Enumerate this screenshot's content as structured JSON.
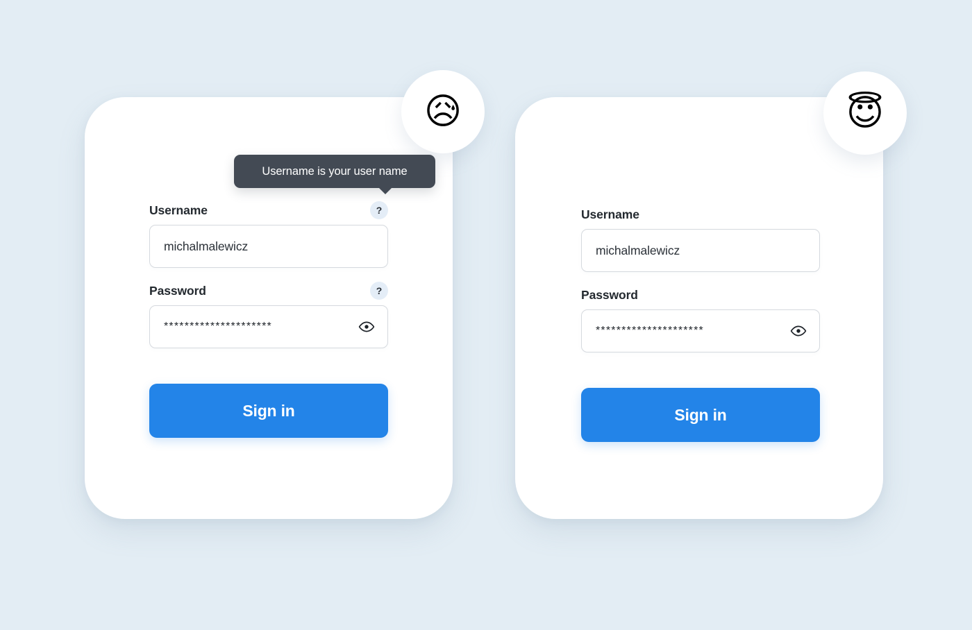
{
  "background_color": "#e3edf4",
  "accent_color": "#2384e8",
  "tooltip_color": "#434a54",
  "cards": [
    {
      "id": "bad-example",
      "emoji": "😥",
      "emoji_name": "sad-but-relieved-face-emoji",
      "tooltip": {
        "text": "Username is your user name",
        "visible": true
      },
      "fields": [
        {
          "label": "Username",
          "value": "michalmalewicz",
          "type": "text",
          "help_badge": "?",
          "has_help_badge": true,
          "has_eye_toggle": false
        },
        {
          "label": "Password",
          "value": "*********************",
          "type": "password",
          "help_badge": "?",
          "has_help_badge": true,
          "has_eye_toggle": true,
          "eye_icon": "eye-icon"
        }
      ],
      "submit_label": "Sign in"
    },
    {
      "id": "good-example",
      "emoji": "😇",
      "emoji_name": "smiling-face-with-halo-emoji",
      "tooltip": {
        "text": "",
        "visible": false
      },
      "fields": [
        {
          "label": "Username",
          "value": "michalmalewicz",
          "type": "text",
          "help_badge": "",
          "has_help_badge": false,
          "has_eye_toggle": false
        },
        {
          "label": "Password",
          "value": "*********************",
          "type": "password",
          "help_badge": "",
          "has_help_badge": false,
          "has_eye_toggle": true,
          "eye_icon": "eye-icon"
        }
      ],
      "submit_label": "Sign in"
    }
  ]
}
